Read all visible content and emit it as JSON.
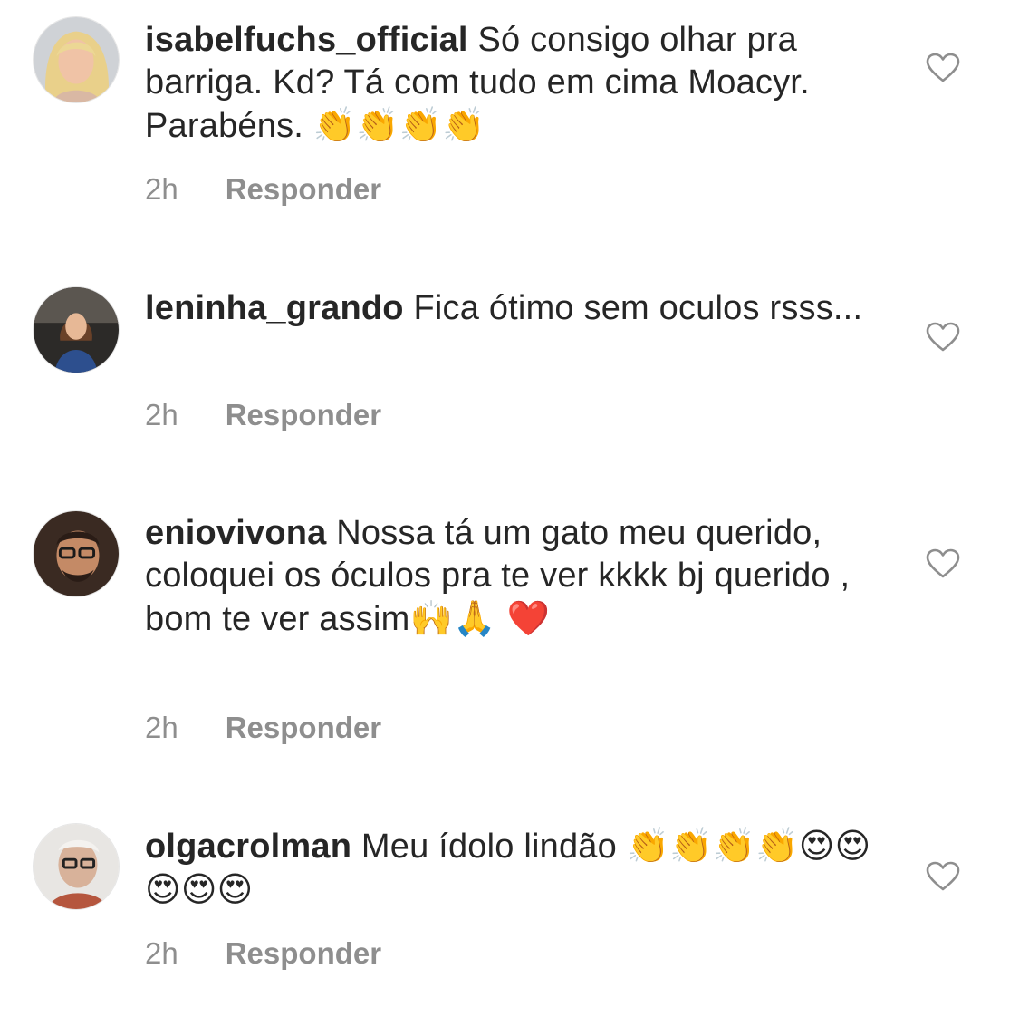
{
  "comments": [
    {
      "username": "isabelfuchs_official",
      "text": "Só consigo olhar pra barriga. Kd? Tá com tudo em cima Moacyr. Parabéns.",
      "emojis": "👏👏👏👏",
      "time": "2h",
      "reply_label": "Responder"
    },
    {
      "username": "leninha_grando",
      "text": "Fica ótimo sem oculos rsss...",
      "emojis": "",
      "time": "2h",
      "reply_label": "Responder"
    },
    {
      "username": "eniovivona",
      "text": "Nossa tá um gato meu querido, coloquei os óculos pra te ver kkkk bj querido , bom te ver assim",
      "emojis": "🙌🙏 ❤️",
      "time": "2h",
      "reply_label": "Responder"
    },
    {
      "username": "olgacrolman",
      "text": "Meu ídolo lindão",
      "emojis": "👏👏👏👏😍😍😍😍😍",
      "time": "2h",
      "reply_label": "Responder"
    }
  ],
  "icons": {
    "like": "heart-outline-icon",
    "avatar": "user-avatar"
  },
  "colors": {
    "text": "#262626",
    "secondary": "#8e8e8e",
    "background": "#ffffff"
  }
}
